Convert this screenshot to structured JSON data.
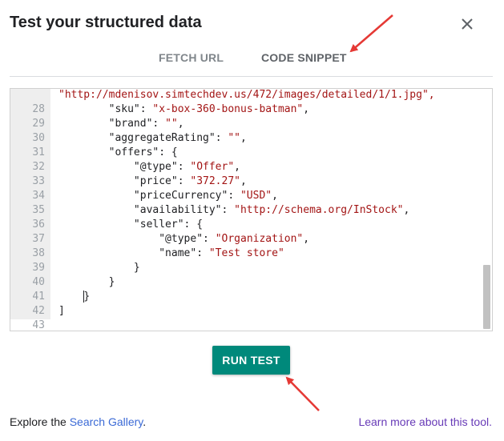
{
  "dialog": {
    "title": "Test your structured data",
    "close_icon": "close-icon"
  },
  "tabs": [
    {
      "label": "FETCH URL",
      "active": false
    },
    {
      "label": "CODE SNIPPET",
      "active": true
    }
  ],
  "editor": {
    "lines": [
      {
        "n": "",
        "tokens": [
          {
            "t": "s",
            "v": "\"http://mdenisov.simtechdev.us/472/images/detailed/1/1.jpg\","
          }
        ]
      },
      {
        "n": "28",
        "tokens": [
          {
            "t": "p",
            "v": "        "
          },
          {
            "t": "k",
            "v": "\"sku\""
          },
          {
            "t": "p",
            "v": ": "
          },
          {
            "t": "s",
            "v": "\"x-box-360-bonus-batman\""
          },
          {
            "t": "p",
            "v": ","
          }
        ]
      },
      {
        "n": "29",
        "tokens": [
          {
            "t": "p",
            "v": "        "
          },
          {
            "t": "k",
            "v": "\"brand\""
          },
          {
            "t": "p",
            "v": ": "
          },
          {
            "t": "s",
            "v": "\"\""
          },
          {
            "t": "p",
            "v": ","
          }
        ]
      },
      {
        "n": "30",
        "tokens": [
          {
            "t": "p",
            "v": "        "
          },
          {
            "t": "k",
            "v": "\"aggregateRating\""
          },
          {
            "t": "p",
            "v": ": "
          },
          {
            "t": "s",
            "v": "\"\""
          },
          {
            "t": "p",
            "v": ","
          }
        ]
      },
      {
        "n": "31",
        "tokens": [
          {
            "t": "p",
            "v": "        "
          },
          {
            "t": "k",
            "v": "\"offers\""
          },
          {
            "t": "p",
            "v": ": {"
          }
        ]
      },
      {
        "n": "32",
        "tokens": [
          {
            "t": "p",
            "v": "            "
          },
          {
            "t": "k",
            "v": "\"@type\""
          },
          {
            "t": "p",
            "v": ": "
          },
          {
            "t": "s",
            "v": "\"Offer\""
          },
          {
            "t": "p",
            "v": ","
          }
        ]
      },
      {
        "n": "33",
        "tokens": [
          {
            "t": "p",
            "v": "            "
          },
          {
            "t": "k",
            "v": "\"price\""
          },
          {
            "t": "p",
            "v": ": "
          },
          {
            "t": "s",
            "v": "\"372.27\""
          },
          {
            "t": "p",
            "v": ","
          }
        ]
      },
      {
        "n": "34",
        "tokens": [
          {
            "t": "p",
            "v": "            "
          },
          {
            "t": "k",
            "v": "\"priceCurrency\""
          },
          {
            "t": "p",
            "v": ": "
          },
          {
            "t": "s",
            "v": "\"USD\""
          },
          {
            "t": "p",
            "v": ","
          }
        ]
      },
      {
        "n": "35",
        "tokens": [
          {
            "t": "p",
            "v": "            "
          },
          {
            "t": "k",
            "v": "\"availability\""
          },
          {
            "t": "p",
            "v": ": "
          },
          {
            "t": "s",
            "v": "\"http://schema.org/InStock\""
          },
          {
            "t": "p",
            "v": ","
          }
        ]
      },
      {
        "n": "36",
        "tokens": [
          {
            "t": "p",
            "v": "            "
          },
          {
            "t": "k",
            "v": "\"seller\""
          },
          {
            "t": "p",
            "v": ": {"
          }
        ]
      },
      {
        "n": "37",
        "tokens": [
          {
            "t": "p",
            "v": "                "
          },
          {
            "t": "k",
            "v": "\"@type\""
          },
          {
            "t": "p",
            "v": ": "
          },
          {
            "t": "s",
            "v": "\"Organization\""
          },
          {
            "t": "p",
            "v": ","
          }
        ]
      },
      {
        "n": "38",
        "tokens": [
          {
            "t": "p",
            "v": "                "
          },
          {
            "t": "k",
            "v": "\"name\""
          },
          {
            "t": "p",
            "v": ": "
          },
          {
            "t": "s",
            "v": "\"Test store\""
          }
        ]
      },
      {
        "n": "39",
        "tokens": [
          {
            "t": "p",
            "v": "            }"
          }
        ]
      },
      {
        "n": "40",
        "tokens": [
          {
            "t": "p",
            "v": "        }"
          }
        ]
      },
      {
        "n": "41",
        "tokens": [
          {
            "t": "p",
            "v": "    "
          },
          {
            "t": "cursor",
            "v": ""
          },
          {
            "t": "p",
            "v": "}"
          }
        ]
      },
      {
        "n": "42",
        "tokens": [
          {
            "t": "p",
            "v": "]"
          }
        ]
      },
      {
        "n": "43",
        "tokens": []
      }
    ]
  },
  "actions": {
    "run_test_label": "RUN TEST"
  },
  "footer": {
    "explore_prefix": "Explore the ",
    "gallery_link": "Search Gallery",
    "explore_suffix": ".",
    "learn_more": "Learn more about this tool."
  },
  "colors": {
    "accent": "#00897b",
    "annotation_arrow": "#e53935",
    "string": "#a31515",
    "link": "#673ab7"
  }
}
